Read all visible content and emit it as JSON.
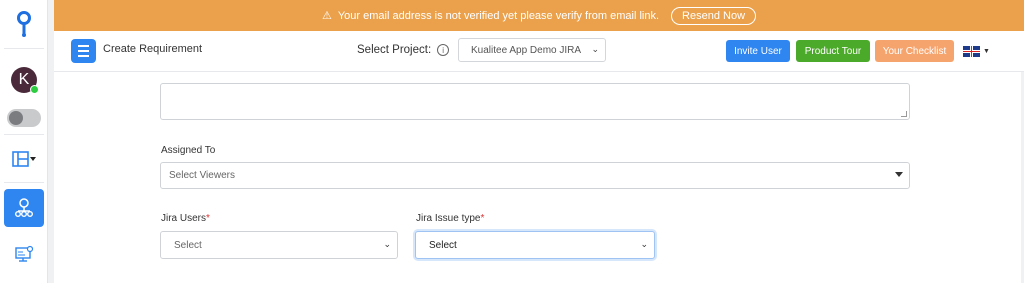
{
  "banner": {
    "message": "Your email address is not verified yet please verify from email link.",
    "resend_label": "Resend Now",
    "bg_color": "#eba14b"
  },
  "sidebar": {
    "avatar_initial": "K",
    "items": [
      {
        "name": "logo",
        "icon": "location-pin-logo-icon"
      },
      {
        "name": "avatar",
        "icon": "avatar"
      },
      {
        "name": "toggle",
        "icon": "toggle-switch"
      },
      {
        "name": "layout",
        "icon": "layout-grid-icon"
      },
      {
        "name": "requirements",
        "icon": "hierarchy-icon",
        "active": true
      },
      {
        "name": "monitor",
        "icon": "monitor-settings-icon"
      }
    ],
    "active_color": "#2f86f0"
  },
  "header": {
    "page_title": "Create Requirement",
    "select_project_label": "Select Project:",
    "project_value": "Kualitee App Demo JIRA",
    "buttons": {
      "invite": "Invite User",
      "tour": "Product Tour",
      "checklist": "Your Checklist"
    },
    "language": "en-GB"
  },
  "form": {
    "assigned_to_label": "Assigned To",
    "viewers_placeholder": "Select Viewers",
    "jira_users_label": "Jira Users",
    "jira_issue_type_label": "Jira Issue type",
    "required_mark": "*",
    "jira_users_value": "Select",
    "jira_issue_type_value": "Select"
  }
}
